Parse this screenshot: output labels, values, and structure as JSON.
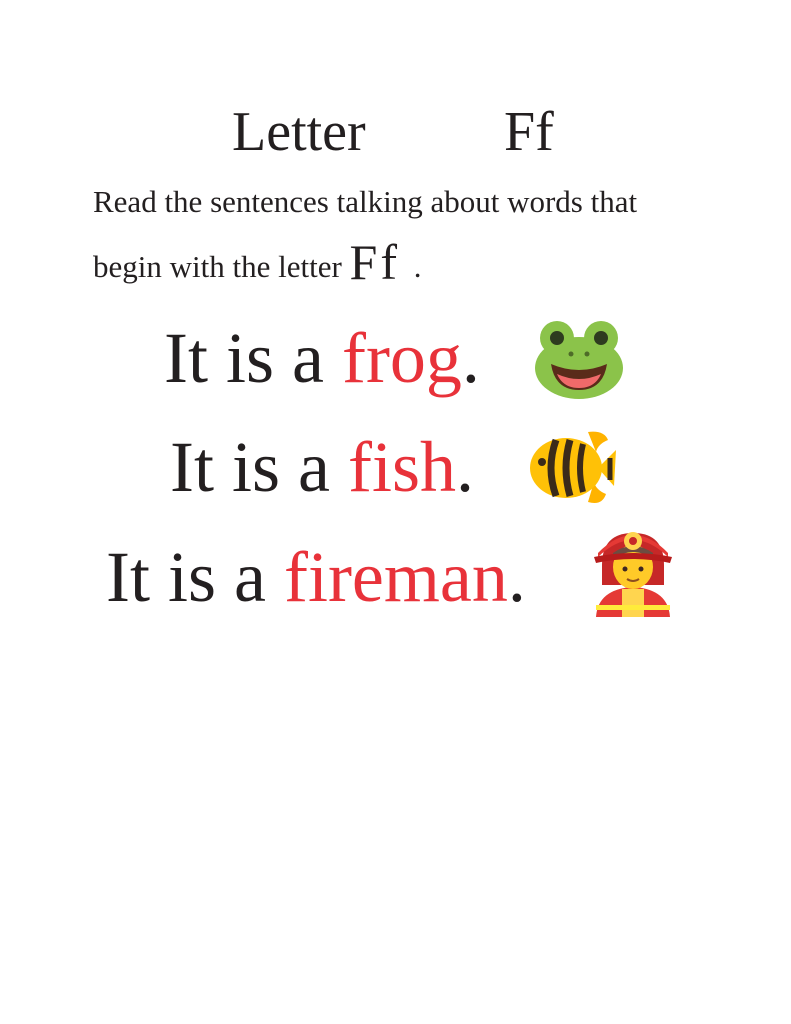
{
  "title": {
    "word": "Letter",
    "letters": "Ff"
  },
  "instructions": {
    "line1": "Read the sentences talking about words that",
    "line2_text": "begin with the letter",
    "line2_letters": "Ff",
    "line2_end": "."
  },
  "sentences": [
    {
      "prefix": "It is a ",
      "word": "frog",
      "end": ".",
      "icon": "frog-icon"
    },
    {
      "prefix": "It is a ",
      "word": "fish",
      "end": ".",
      "icon": "tropical-fish-icon"
    },
    {
      "prefix": "It is a ",
      "word": "fireman",
      "end": ".",
      "icon": "firefighter-icon"
    }
  ],
  "colors": {
    "text": "#231f20",
    "highlight": "#e8323a"
  }
}
